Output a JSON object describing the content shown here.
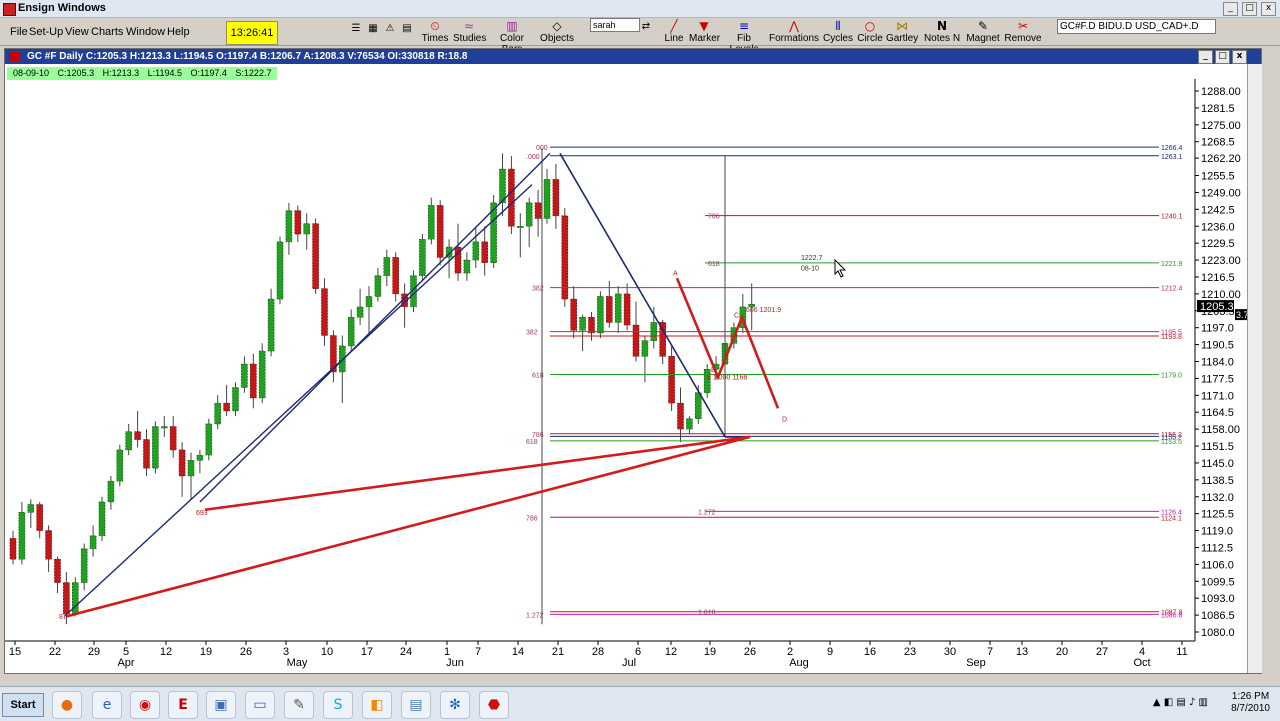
{
  "window": {
    "title": "Ensign Windows"
  },
  "menu": [
    "File",
    "Set-Up",
    "View",
    "Charts",
    "Window",
    "Help"
  ],
  "clock": "13:26:41",
  "toolbar_left": [
    {
      "label": "Times",
      "icon": "⏲"
    },
    {
      "label": "Studies",
      "icon": "≈"
    },
    {
      "label": "Color Bars",
      "icon": "▥"
    },
    {
      "label": "Objects",
      "icon": "◇"
    }
  ],
  "toolbar_draw": [
    {
      "label": "Line",
      "icon": "╱"
    },
    {
      "label": "Marker",
      "icon": "▼"
    },
    {
      "label": "Fib Levels",
      "icon": "≡"
    },
    {
      "label": "Formations",
      "icon": "⋀"
    },
    {
      "label": "Cycles",
      "icon": "⫴"
    },
    {
      "label": "Circle",
      "icon": "○"
    },
    {
      "label": "Gartley",
      "icon": "⋈"
    },
    {
      "label": "Notes N",
      "icon": "N"
    },
    {
      "label": "Magnet",
      "icon": "✎"
    },
    {
      "label": "Remove",
      "icon": "✂"
    }
  ],
  "profile": "sarah",
  "symbols": "GC#F.D BIDU.D USD_CAD+.D",
  "chart": {
    "title": "GC #F Daily C:1205.3 H:1213.3 L:1194.5 O:1197.4 B:1206.7 A:1208.3 V:76534 OI:330818 R:18.8",
    "info": {
      "date": "08-09-10",
      "c": "C:1205.3",
      "h": "H:1213.3",
      "l": "L:1194.5",
      "o": "O:1197.4",
      "s": "S:1222.7"
    },
    "current_price": "1205.3",
    "current_price_tail": "3.72",
    "cursor_tip": [
      "1222.7",
      "08-10"
    ]
  },
  "taskbar": {
    "start": "Start",
    "time": "1:26 PM",
    "date": "8/7/2010"
  },
  "chart_data": {
    "type": "candlestick",
    "y_axis": {
      "tick_labels": [
        "1288.00",
        "1281.5",
        "1275.00",
        "1268.5",
        "1262.20",
        "1255.5",
        "1249.00",
        "1242.5",
        "1236.0",
        "1229.5",
        "1223.00",
        "1216.5",
        "1210.00",
        "1203.5",
        "1197.0",
        "1190.5",
        "1184.0",
        "1177.5",
        "1171.0",
        "1164.5",
        "1158.00",
        "1151.5",
        "1145.0",
        "1138.5",
        "1132.0",
        "1125.5",
        "1119.0",
        "1112.5",
        "1106.0",
        "1099.5",
        "1093.0",
        "1086.5",
        "1080.0"
      ],
      "range": [
        1080.0,
        1288.0
      ]
    },
    "x_axis": {
      "day_labels": [
        "15",
        "22",
        "29",
        "5",
        "12",
        "19",
        "26",
        "3",
        "10",
        "17",
        "24",
        "1",
        "7",
        "14",
        "21",
        "28",
        "6",
        "12",
        "19",
        "26",
        "2",
        "9",
        "16",
        "23",
        "30",
        "7",
        "13",
        "20",
        "27",
        "4",
        "11"
      ],
      "month_labels": [
        "Apr",
        "May",
        "Jun",
        "Jul",
        "Aug",
        "Sep",
        "Oct"
      ]
    },
    "fib_right_labels": [
      "1266.4",
      "1263.1",
      "1240.1",
      "1221.9",
      "1212.4",
      "1195.5",
      "1193.8",
      "1179.0",
      "1156.2",
      "1155.2",
      "1153.5",
      "1126.4",
      "1124.1",
      "1087.8",
      "1086.8"
    ],
    "fib_left_labels": [
      ".000",
      "000",
      "786",
      "618",
      "382",
      "382",
      "618",
      "786",
      "786",
      "618",
      "1.272",
      "1.272",
      "1.618"
    ],
    "annotations": {
      "pattern_text": "606 1201.9",
      "pattern_text2": "8 1.000 1168",
      "point_c": "C",
      "point_d": "D",
      "point_a": "A",
      "point_b": "B",
      "low_mark": "87",
      "mid_mark": "693"
    },
    "candles": [
      [
        1116,
        1119,
        1106,
        1108
      ],
      [
        1108,
        1130,
        1106,
        1126
      ],
      [
        1126,
        1131,
        1120,
        1129
      ],
      [
        1129,
        1130,
        1116,
        1119
      ],
      [
        1119,
        1121,
        1103,
        1108
      ],
      [
        1108,
        1109,
        1095,
        1099
      ],
      [
        1099,
        1103,
        1083,
        1087
      ],
      [
        1087,
        1101,
        1086,
        1099
      ],
      [
        1099,
        1114,
        1096,
        1112
      ],
      [
        1112,
        1121,
        1109,
        1117
      ],
      [
        1117,
        1132,
        1115,
        1130
      ],
      [
        1130,
        1140,
        1127,
        1138
      ],
      [
        1138,
        1152,
        1136,
        1150
      ],
      [
        1150,
        1160,
        1148,
        1157
      ],
      [
        1157,
        1165,
        1151,
        1154
      ],
      [
        1154,
        1158,
        1140,
        1143
      ],
      [
        1143,
        1161,
        1141,
        1159
      ],
      [
        1159,
        1163,
        1155,
        1159
      ],
      [
        1159,
        1163,
        1147,
        1150
      ],
      [
        1150,
        1153,
        1132,
        1140
      ],
      [
        1140,
        1149,
        1131,
        1146
      ],
      [
        1146,
        1150,
        1141,
        1148
      ],
      [
        1148,
        1162,
        1146,
        1160
      ],
      [
        1160,
        1171,
        1158,
        1168
      ],
      [
        1168,
        1175,
        1163,
        1165
      ],
      [
        1165,
        1176,
        1163,
        1174
      ],
      [
        1174,
        1186,
        1172,
        1183
      ],
      [
        1183,
        1187,
        1166,
        1170
      ],
      [
        1170,
        1191,
        1168,
        1188
      ],
      [
        1188,
        1212,
        1186,
        1208
      ],
      [
        1208,
        1232,
        1206,
        1230
      ],
      [
        1230,
        1245,
        1225,
        1242
      ],
      [
        1242,
        1244,
        1230,
        1233
      ],
      [
        1233,
        1241,
        1227,
        1237
      ],
      [
        1237,
        1239,
        1210,
        1212
      ],
      [
        1212,
        1216,
        1190,
        1194
      ],
      [
        1194,
        1196,
        1176,
        1180
      ],
      [
        1180,
        1194,
        1168,
        1190
      ],
      [
        1190,
        1204,
        1188,
        1201
      ],
      [
        1201,
        1212,
        1198,
        1205
      ],
      [
        1205,
        1213,
        1195,
        1209
      ],
      [
        1209,
        1220,
        1207,
        1217
      ],
      [
        1217,
        1227,
        1213,
        1224
      ],
      [
        1224,
        1226,
        1207,
        1210
      ],
      [
        1210,
        1214,
        1197,
        1205
      ],
      [
        1205,
        1219,
        1203,
        1217
      ],
      [
        1217,
        1233,
        1215,
        1231
      ],
      [
        1231,
        1247,
        1229,
        1244
      ],
      [
        1244,
        1246,
        1221,
        1224
      ],
      [
        1224,
        1231,
        1216,
        1228
      ],
      [
        1228,
        1237,
        1215,
        1218
      ],
      [
        1218,
        1226,
        1215,
        1223
      ],
      [
        1223,
        1236,
        1220,
        1230
      ],
      [
        1230,
        1236,
        1217,
        1222
      ],
      [
        1222,
        1248,
        1220,
        1245
      ],
      [
        1245,
        1264,
        1240,
        1258
      ],
      [
        1258,
        1263,
        1233,
        1236
      ],
      [
        1236,
        1241,
        1224,
        1236
      ],
      [
        1236,
        1247,
        1228,
        1245
      ],
      [
        1245,
        1250,
        1232,
        1239
      ],
      [
        1239,
        1258,
        1237,
        1254
      ],
      [
        1254,
        1260,
        1235,
        1240
      ],
      [
        1240,
        1243,
        1205,
        1208
      ],
      [
        1208,
        1213,
        1193,
        1196
      ],
      [
        1196,
        1202,
        1188,
        1201
      ],
      [
        1201,
        1203,
        1192,
        1195
      ],
      [
        1195,
        1211,
        1193,
        1209
      ],
      [
        1209,
        1215,
        1197,
        1199
      ],
      [
        1199,
        1213,
        1195,
        1210
      ],
      [
        1210,
        1214,
        1196,
        1198
      ],
      [
        1198,
        1207,
        1184,
        1186
      ],
      [
        1186,
        1194,
        1176,
        1192
      ],
      [
        1192,
        1205,
        1189,
        1199
      ],
      [
        1199,
        1200,
        1183,
        1186
      ],
      [
        1186,
        1190,
        1165,
        1168
      ],
      [
        1168,
        1174,
        1153,
        1158
      ],
      [
        1158,
        1163,
        1156,
        1162
      ],
      [
        1162,
        1175,
        1160,
        1172
      ],
      [
        1172,
        1183,
        1170,
        1181
      ],
      [
        1181,
        1186,
        1177,
        1183
      ],
      [
        1183,
        1193,
        1181,
        1191
      ],
      [
        1191,
        1199,
        1189,
        1197
      ],
      [
        1197,
        1210,
        1195,
        1205
      ],
      [
        1205,
        1214,
        1196,
        1206
      ]
    ]
  }
}
